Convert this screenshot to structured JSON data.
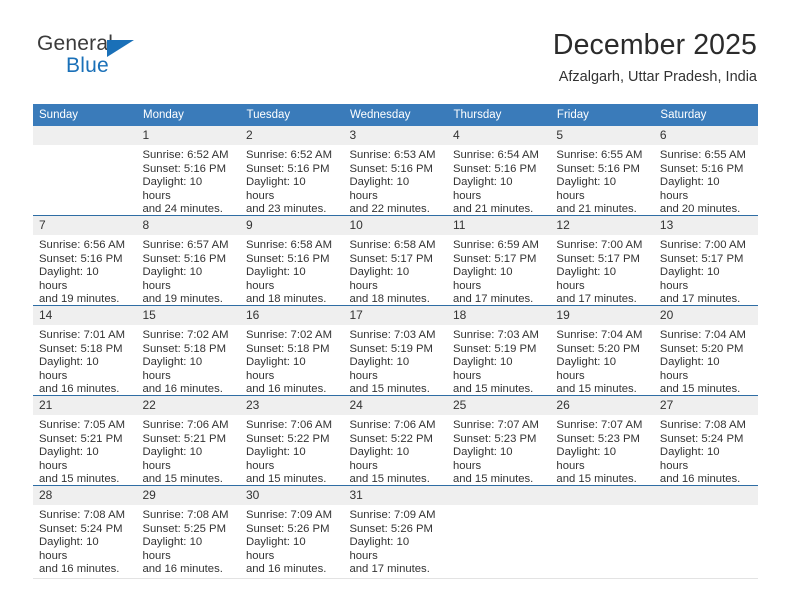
{
  "brand": {
    "name_part1": "General",
    "name_part2": "Blue",
    "triangle_color": "#1a70b8",
    "text_color": "#3b3b3b"
  },
  "header": {
    "title": "December 2025",
    "subtitle": "Afzalgarh, Uttar Pradesh, India"
  },
  "theme": {
    "header_blue": "#3a7bba",
    "rule_blue": "#2e6da4",
    "daynum_band": "#efefef",
    "text": "#333333"
  },
  "weekday_headers": [
    "Sunday",
    "Monday",
    "Tuesday",
    "Wednesday",
    "Thursday",
    "Friday",
    "Saturday"
  ],
  "weeks": [
    [
      {
        "day": "",
        "sunrise": "",
        "sunset": "",
        "daylight_line1": "",
        "daylight_line2": ""
      },
      {
        "day": "1",
        "sunrise": "Sunrise: 6:52 AM",
        "sunset": "Sunset: 5:16 PM",
        "daylight_line1": "Daylight: 10 hours",
        "daylight_line2": "and 24 minutes."
      },
      {
        "day": "2",
        "sunrise": "Sunrise: 6:52 AM",
        "sunset": "Sunset: 5:16 PM",
        "daylight_line1": "Daylight: 10 hours",
        "daylight_line2": "and 23 minutes."
      },
      {
        "day": "3",
        "sunrise": "Sunrise: 6:53 AM",
        "sunset": "Sunset: 5:16 PM",
        "daylight_line1": "Daylight: 10 hours",
        "daylight_line2": "and 22 minutes."
      },
      {
        "day": "4",
        "sunrise": "Sunrise: 6:54 AM",
        "sunset": "Sunset: 5:16 PM",
        "daylight_line1": "Daylight: 10 hours",
        "daylight_line2": "and 21 minutes."
      },
      {
        "day": "5",
        "sunrise": "Sunrise: 6:55 AM",
        "sunset": "Sunset: 5:16 PM",
        "daylight_line1": "Daylight: 10 hours",
        "daylight_line2": "and 21 minutes."
      },
      {
        "day": "6",
        "sunrise": "Sunrise: 6:55 AM",
        "sunset": "Sunset: 5:16 PM",
        "daylight_line1": "Daylight: 10 hours",
        "daylight_line2": "and 20 minutes."
      }
    ],
    [
      {
        "day": "7",
        "sunrise": "Sunrise: 6:56 AM",
        "sunset": "Sunset: 5:16 PM",
        "daylight_line1": "Daylight: 10 hours",
        "daylight_line2": "and 19 minutes."
      },
      {
        "day": "8",
        "sunrise": "Sunrise: 6:57 AM",
        "sunset": "Sunset: 5:16 PM",
        "daylight_line1": "Daylight: 10 hours",
        "daylight_line2": "and 19 minutes."
      },
      {
        "day": "9",
        "sunrise": "Sunrise: 6:58 AM",
        "sunset": "Sunset: 5:16 PM",
        "daylight_line1": "Daylight: 10 hours",
        "daylight_line2": "and 18 minutes."
      },
      {
        "day": "10",
        "sunrise": "Sunrise: 6:58 AM",
        "sunset": "Sunset: 5:17 PM",
        "daylight_line1": "Daylight: 10 hours",
        "daylight_line2": "and 18 minutes."
      },
      {
        "day": "11",
        "sunrise": "Sunrise: 6:59 AM",
        "sunset": "Sunset: 5:17 PM",
        "daylight_line1": "Daylight: 10 hours",
        "daylight_line2": "and 17 minutes."
      },
      {
        "day": "12",
        "sunrise": "Sunrise: 7:00 AM",
        "sunset": "Sunset: 5:17 PM",
        "daylight_line1": "Daylight: 10 hours",
        "daylight_line2": "and 17 minutes."
      },
      {
        "day": "13",
        "sunrise": "Sunrise: 7:00 AM",
        "sunset": "Sunset: 5:17 PM",
        "daylight_line1": "Daylight: 10 hours",
        "daylight_line2": "and 17 minutes."
      }
    ],
    [
      {
        "day": "14",
        "sunrise": "Sunrise: 7:01 AM",
        "sunset": "Sunset: 5:18 PM",
        "daylight_line1": "Daylight: 10 hours",
        "daylight_line2": "and 16 minutes."
      },
      {
        "day": "15",
        "sunrise": "Sunrise: 7:02 AM",
        "sunset": "Sunset: 5:18 PM",
        "daylight_line1": "Daylight: 10 hours",
        "daylight_line2": "and 16 minutes."
      },
      {
        "day": "16",
        "sunrise": "Sunrise: 7:02 AM",
        "sunset": "Sunset: 5:18 PM",
        "daylight_line1": "Daylight: 10 hours",
        "daylight_line2": "and 16 minutes."
      },
      {
        "day": "17",
        "sunrise": "Sunrise: 7:03 AM",
        "sunset": "Sunset: 5:19 PM",
        "daylight_line1": "Daylight: 10 hours",
        "daylight_line2": "and 15 minutes."
      },
      {
        "day": "18",
        "sunrise": "Sunrise: 7:03 AM",
        "sunset": "Sunset: 5:19 PM",
        "daylight_line1": "Daylight: 10 hours",
        "daylight_line2": "and 15 minutes."
      },
      {
        "day": "19",
        "sunrise": "Sunrise: 7:04 AM",
        "sunset": "Sunset: 5:20 PM",
        "daylight_line1": "Daylight: 10 hours",
        "daylight_line2": "and 15 minutes."
      },
      {
        "day": "20",
        "sunrise": "Sunrise: 7:04 AM",
        "sunset": "Sunset: 5:20 PM",
        "daylight_line1": "Daylight: 10 hours",
        "daylight_line2": "and 15 minutes."
      }
    ],
    [
      {
        "day": "21",
        "sunrise": "Sunrise: 7:05 AM",
        "sunset": "Sunset: 5:21 PM",
        "daylight_line1": "Daylight: 10 hours",
        "daylight_line2": "and 15 minutes."
      },
      {
        "day": "22",
        "sunrise": "Sunrise: 7:06 AM",
        "sunset": "Sunset: 5:21 PM",
        "daylight_line1": "Daylight: 10 hours",
        "daylight_line2": "and 15 minutes."
      },
      {
        "day": "23",
        "sunrise": "Sunrise: 7:06 AM",
        "sunset": "Sunset: 5:22 PM",
        "daylight_line1": "Daylight: 10 hours",
        "daylight_line2": "and 15 minutes."
      },
      {
        "day": "24",
        "sunrise": "Sunrise: 7:06 AM",
        "sunset": "Sunset: 5:22 PM",
        "daylight_line1": "Daylight: 10 hours",
        "daylight_line2": "and 15 minutes."
      },
      {
        "day": "25",
        "sunrise": "Sunrise: 7:07 AM",
        "sunset": "Sunset: 5:23 PM",
        "daylight_line1": "Daylight: 10 hours",
        "daylight_line2": "and 15 minutes."
      },
      {
        "day": "26",
        "sunrise": "Sunrise: 7:07 AM",
        "sunset": "Sunset: 5:23 PM",
        "daylight_line1": "Daylight: 10 hours",
        "daylight_line2": "and 15 minutes."
      },
      {
        "day": "27",
        "sunrise": "Sunrise: 7:08 AM",
        "sunset": "Sunset: 5:24 PM",
        "daylight_line1": "Daylight: 10 hours",
        "daylight_line2": "and 16 minutes."
      }
    ],
    [
      {
        "day": "28",
        "sunrise": "Sunrise: 7:08 AM",
        "sunset": "Sunset: 5:24 PM",
        "daylight_line1": "Daylight: 10 hours",
        "daylight_line2": "and 16 minutes."
      },
      {
        "day": "29",
        "sunrise": "Sunrise: 7:08 AM",
        "sunset": "Sunset: 5:25 PM",
        "daylight_line1": "Daylight: 10 hours",
        "daylight_line2": "and 16 minutes."
      },
      {
        "day": "30",
        "sunrise": "Sunrise: 7:09 AM",
        "sunset": "Sunset: 5:26 PM",
        "daylight_line1": "Daylight: 10 hours",
        "daylight_line2": "and 16 minutes."
      },
      {
        "day": "31",
        "sunrise": "Sunrise: 7:09 AM",
        "sunset": "Sunset: 5:26 PM",
        "daylight_line1": "Daylight: 10 hours",
        "daylight_line2": "and 17 minutes."
      },
      {
        "day": "",
        "sunrise": "",
        "sunset": "",
        "daylight_line1": "",
        "daylight_line2": ""
      },
      {
        "day": "",
        "sunrise": "",
        "sunset": "",
        "daylight_line1": "",
        "daylight_line2": ""
      },
      {
        "day": "",
        "sunrise": "",
        "sunset": "",
        "daylight_line1": "",
        "daylight_line2": ""
      }
    ]
  ]
}
